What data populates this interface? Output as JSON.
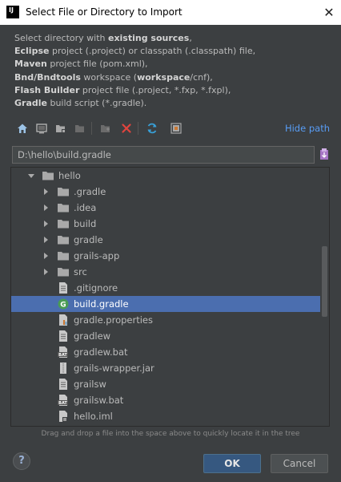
{
  "window": {
    "app_icon_text": "IJ",
    "title": "Select File or Directory to Import"
  },
  "description": {
    "lines": [
      {
        "bold": "",
        "rest": "Select directory with ",
        "bold2": "existing sources",
        "tail": ","
      },
      {
        "bold": "Eclipse",
        "rest": " project (.project) or classpath (.classpath) file,",
        "bold2": "",
        "tail": ""
      },
      {
        "bold": "Maven",
        "rest": " project file (pom.xml),",
        "bold2": "",
        "tail": ""
      },
      {
        "bold": "Bnd/Bndtools",
        "rest": " workspace (",
        "bold2": "workspace",
        "tail": "/cnf),"
      },
      {
        "bold": "Flash Builder",
        "rest": " project file (.project, *.fxp, *.fxpl),",
        "bold2": "",
        "tail": ""
      },
      {
        "bold": "Gradle",
        "rest": " build script (*.gradle).",
        "bold2": "",
        "tail": ""
      }
    ]
  },
  "toolbar": {
    "hide_path_label": "Hide path"
  },
  "path": {
    "value": "D:\\hello\\build.gradle"
  },
  "tree": {
    "root": {
      "label": "hello",
      "expanded": true
    },
    "folders": [
      ".gradle",
      ".idea",
      "build",
      "gradle",
      "grails-app",
      "src"
    ],
    "files": [
      {
        "label": ".gitignore",
        "icon": "text-file-icon"
      },
      {
        "label": "build.gradle",
        "icon": "gradle-file-icon",
        "selected": true
      },
      {
        "label": "gradle.properties",
        "icon": "properties-file-icon"
      },
      {
        "label": "gradlew",
        "icon": "text-file-icon"
      },
      {
        "label": "gradlew.bat",
        "icon": "bat-file-icon"
      },
      {
        "label": "grails-wrapper.jar",
        "icon": "jar-file-icon"
      },
      {
        "label": "grailsw",
        "icon": "text-file-icon"
      },
      {
        "label": "grailsw.bat",
        "icon": "bat-file-icon"
      },
      {
        "label": "hello.iml",
        "icon": "iml-file-icon"
      }
    ]
  },
  "hint": "Drag and drop a file into the space above to quickly locate it in the tree",
  "buttons": {
    "help": "?",
    "ok": "OK",
    "cancel": "Cancel"
  },
  "colors": {
    "selection": "#4b6eaf",
    "link": "#589df6",
    "ok_button": "#365880",
    "background": "#3c3f41"
  }
}
